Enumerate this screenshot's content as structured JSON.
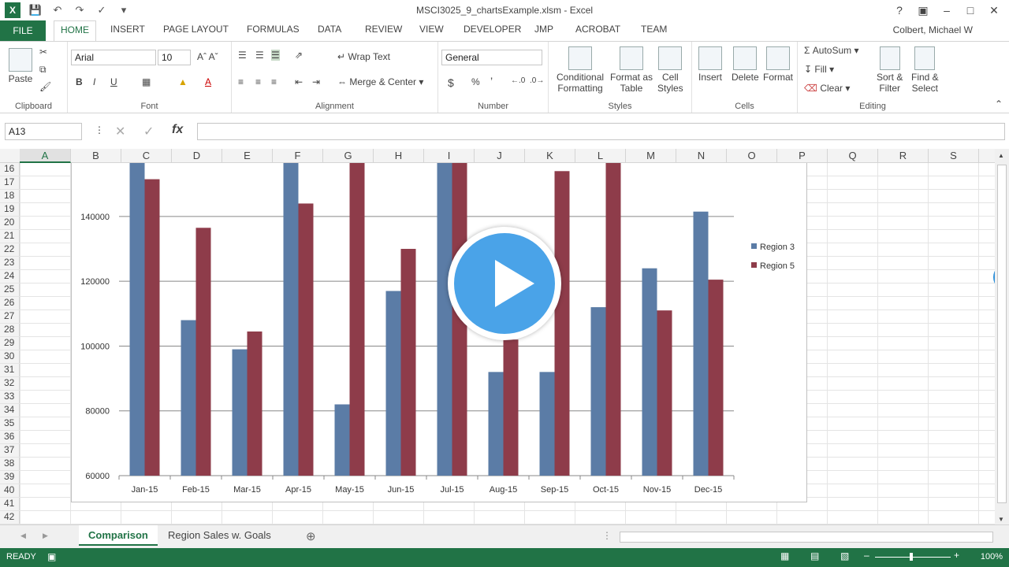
{
  "window": {
    "title": "MSCI3025_9_chartsExample.xlsm - Excel",
    "user": "Colbert, Michael W"
  },
  "ribbon_tabs": [
    "FILE",
    "HOME",
    "INSERT",
    "PAGE LAYOUT",
    "FORMULAS",
    "DATA",
    "REVIEW",
    "VIEW",
    "DEVELOPER",
    "JMP",
    "ACROBAT",
    "TEAM"
  ],
  "ribbon": {
    "clipboard": {
      "label": "Clipboard",
      "paste": "Paste"
    },
    "font": {
      "label": "Font",
      "name": "Arial",
      "size": "10"
    },
    "alignment": {
      "label": "Alignment",
      "wrap": "Wrap Text",
      "merge": "Merge & Center"
    },
    "number": {
      "label": "Number",
      "format": "General",
      "dollar": "$",
      "percent": "%",
      "comma": "’"
    },
    "styles": {
      "label": "Styles",
      "cond": "Conditional",
      "cond2": "Formatting",
      "fmt": "Format as",
      "fmt2": "Table",
      "cell": "Cell",
      "cell2": "Styles"
    },
    "cells": {
      "label": "Cells",
      "insert": "Insert",
      "delete": "Delete",
      "format": "Format"
    },
    "editing": {
      "label": "Editing",
      "autosum": "AutoSum",
      "fill": "Fill",
      "clear": "Clear",
      "sort": "Sort &",
      "sort2": "Filter",
      "find": "Find &",
      "find2": "Select"
    }
  },
  "formula_bar": {
    "name_box": "A13",
    "fx": "fx",
    "value": ""
  },
  "columns": [
    "A",
    "B",
    "C",
    "D",
    "E",
    "F",
    "G",
    "H",
    "I",
    "J",
    "K",
    "L",
    "M",
    "N",
    "O",
    "P",
    "Q",
    "R",
    "S"
  ],
  "rows": [
    "16",
    "17",
    "18",
    "19",
    "20",
    "21",
    "22",
    "23",
    "24",
    "25",
    "26",
    "27",
    "28",
    "29",
    "30",
    "31",
    "32",
    "33",
    "34",
    "35",
    "36",
    "37",
    "38",
    "39",
    "40",
    "41",
    "42"
  ],
  "chart_data": {
    "type": "bar",
    "categories": [
      "Jan-15",
      "Feb-15",
      "Mar-15",
      "Apr-15",
      "May-15",
      "Jun-15",
      "Jul-15",
      "Aug-15",
      "Sep-15",
      "Oct-15",
      "Nov-15",
      "Dec-15"
    ],
    "series": [
      {
        "name": "Region 3",
        "values": [
          160000,
          108000,
          99000,
          160000,
          82000,
          117000,
          160000,
          92000,
          92000,
          112000,
          124000,
          141500
        ],
        "color": "#5b7ca6"
      },
      {
        "name": "Region 5",
        "values": [
          151500,
          136500,
          104500,
          144000,
          160000,
          130000,
          160000,
          102000,
          154000,
          160000,
          111000,
          120500
        ],
        "color": "#8e3c4a"
      }
    ],
    "yticks": [
      "60000",
      "80000",
      "100000",
      "120000",
      "140000"
    ],
    "ylim": [
      60000,
      156500
    ],
    "legend": "right",
    "grid": true
  },
  "sheets": [
    "Comparison",
    "Region Sales w. Goals"
  ],
  "status": {
    "ready": "READY",
    "zoom": "100%"
  }
}
